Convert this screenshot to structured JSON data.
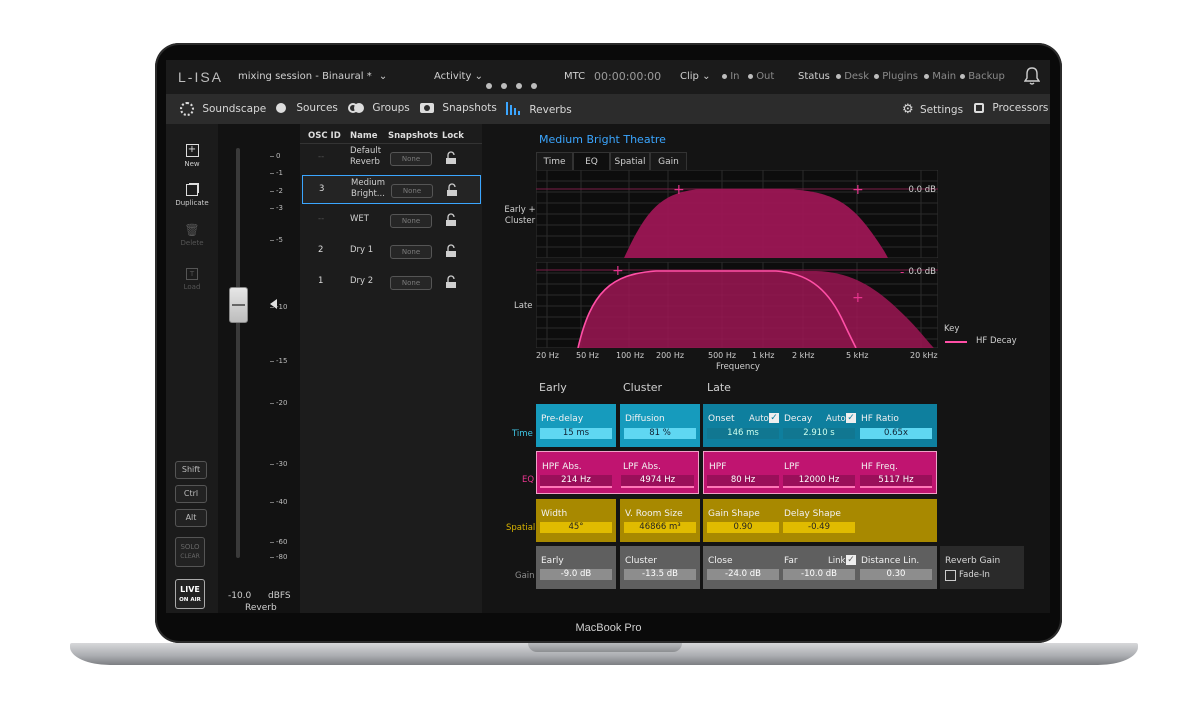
{
  "device_label": "MacBook Pro",
  "app": {
    "logo": "L-ISA",
    "session": "mixing session - Binaural *",
    "activity_label": "Activity",
    "mtc_label": "MTC",
    "mtc_value": "00:00:00:00",
    "clip_label": "Clip",
    "clip_in": "In",
    "clip_out": "Out",
    "status_label": "Status",
    "status_items": [
      "Desk",
      "Plugins",
      "Main",
      "Backup"
    ]
  },
  "nav": {
    "items": [
      "Soundscape",
      "Sources",
      "Groups",
      "Snapshots",
      "Reverbs"
    ],
    "active": "Reverbs",
    "right_items": [
      "Settings",
      "Processors"
    ]
  },
  "side_buttons": {
    "new": "New",
    "duplicate": "Duplicate",
    "delete": "Delete",
    "load": "Load",
    "shift": "Shift",
    "ctrl": "Ctrl",
    "alt": "Alt",
    "solo": "SOLO",
    "solo_clear": "CLEAR",
    "live": "LIVE",
    "live_sub": "ON AIR"
  },
  "fader": {
    "scale": [
      "0",
      "-1",
      "-2",
      "-3",
      "-5",
      "-10",
      "-15",
      "-20",
      "-30",
      "-40",
      "-60",
      "-80"
    ],
    "value": "-10.0",
    "unit": "dBFS",
    "name": "Reverb"
  },
  "reverb_list": {
    "headers": [
      "OSC ID",
      "Name",
      "Snapshots",
      "Lock"
    ],
    "rows": [
      {
        "id": "--",
        "name": "Default Reverb",
        "snap": "None"
      },
      {
        "id": "3",
        "name": "Medium Bright...",
        "snap": "None",
        "selected": true
      },
      {
        "id": "--",
        "name": "WET",
        "snap": "None"
      },
      {
        "id": "2",
        "name": "Dry 1",
        "snap": "None"
      },
      {
        "id": "1",
        "name": "Dry 2",
        "snap": "None"
      }
    ]
  },
  "detail": {
    "title": "Medium Bright Theatre",
    "tabs": [
      "Time",
      "EQ",
      "Spatial",
      "Gain"
    ],
    "active_tab": "EQ",
    "graph_early_label": "Early + Cluster",
    "graph_late_label": "Late",
    "db_label": "0.0 dB",
    "freq_ticks": [
      "20 Hz",
      "50 Hz",
      "100 Hz",
      "200 Hz",
      "500 Hz",
      "1 kHz",
      "2 kHz",
      "5 kHz",
      "20 kHz"
    ],
    "freq_axis_label": "Frequency",
    "key_label": "Key",
    "key_item": "HF Decay",
    "col_headers": [
      "Early",
      "Cluster",
      "Late"
    ],
    "row_labels": [
      "Time",
      "EQ",
      "Spatial",
      "Gain"
    ],
    "row_colors": {
      "Time": "#3fc6e6",
      "EQ": "#e8358f",
      "Spatial": "#d9b400",
      "Gain": "#8e8e8e"
    }
  },
  "params": {
    "time": {
      "predelay": {
        "label": "Pre-delay",
        "value": "15 ms"
      },
      "diffusion": {
        "label": "Diffusion",
        "value": "81 %"
      },
      "onset": {
        "label": "Onset",
        "auto": "Auto",
        "value": "146 ms"
      },
      "decay": {
        "label": "Decay",
        "auto": "Auto",
        "value": "2.910 s"
      },
      "hf_ratio": {
        "label": "HF Ratio",
        "value": "0.65x"
      }
    },
    "eq": {
      "hpf_abs": {
        "label": "HPF Abs.",
        "value": "214 Hz"
      },
      "lpf_abs": {
        "label": "LPF Abs.",
        "value": "4974 Hz"
      },
      "hpf": {
        "label": "HPF",
        "value": "80 Hz"
      },
      "lpf": {
        "label": "LPF",
        "value": "12000 Hz"
      },
      "hf_freq": {
        "label": "HF Freq.",
        "value": "5117 Hz"
      }
    },
    "spatial": {
      "width": {
        "label": "Width",
        "value": "45°"
      },
      "room_size": {
        "label": "V. Room Size",
        "value": "46866 m³"
      },
      "gain_shape": {
        "label": "Gain Shape",
        "value": "0.90"
      },
      "delay_shape": {
        "label": "Delay Shape",
        "value": "-0.49"
      }
    },
    "gain": {
      "early": {
        "label": "Early",
        "value": "-9.0 dB"
      },
      "cluster": {
        "label": "Cluster",
        "value": "-13.5 dB"
      },
      "close": {
        "label": "Close",
        "value": "-24.0 dB"
      },
      "far": {
        "label": "Far",
        "link": "Link",
        "value": "-10.0 dB"
      },
      "distance_lin": {
        "label": "Distance Lin.",
        "value": "0.30"
      },
      "reverb_gain": {
        "label": "Reverb Gain",
        "fade_in": "Fade-In"
      }
    }
  }
}
